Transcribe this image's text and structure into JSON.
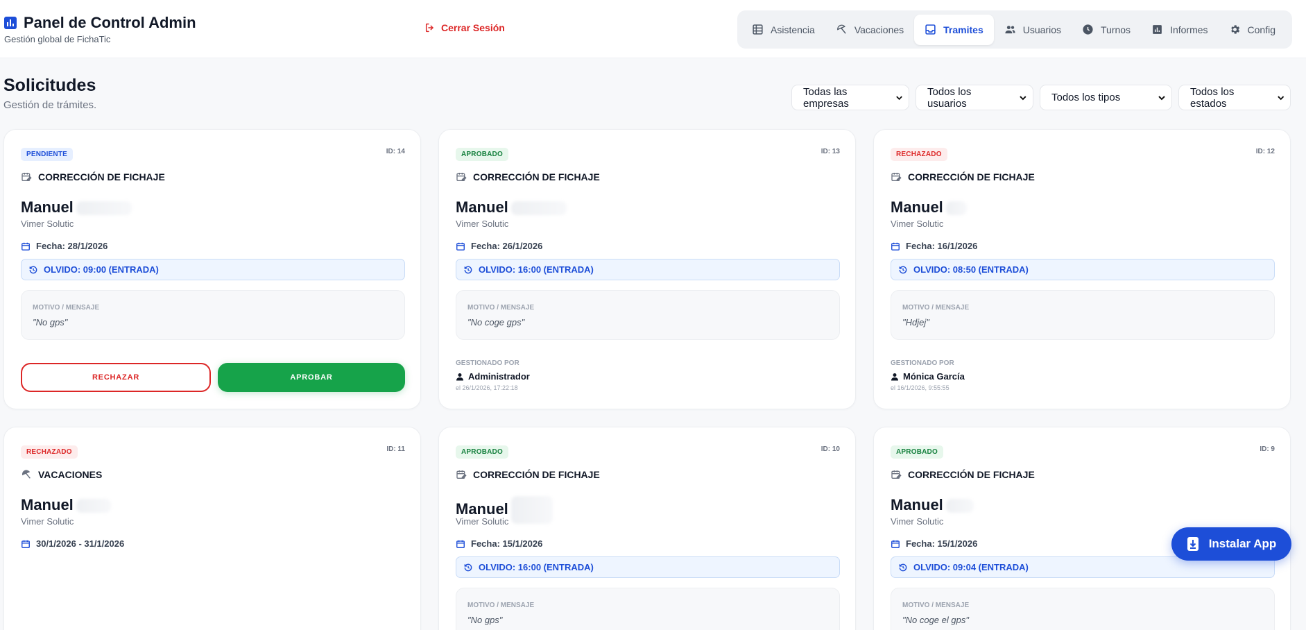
{
  "header": {
    "title": "Panel de Control Admin",
    "subtitle": "Gestión global de FichaTic",
    "logout_label": "Cerrar Sesión"
  },
  "nav": [
    {
      "label": "Asistencia",
      "icon": "table-icon",
      "active": false
    },
    {
      "label": "Vacaciones",
      "icon": "beach-umbrella-icon",
      "active": false
    },
    {
      "label": "Tramites",
      "icon": "inbox-icon",
      "active": true
    },
    {
      "label": "Usuarios",
      "icon": "users-icon",
      "active": false
    },
    {
      "label": "Turnos",
      "icon": "clock-icon",
      "active": false
    },
    {
      "label": "Informes",
      "icon": "bar-chart-icon",
      "active": false
    },
    {
      "label": "Config",
      "icon": "gear-icon",
      "active": false
    }
  ],
  "section": {
    "title": "Solicitudes",
    "subtitle": "Gestión de trámites."
  },
  "filters": [
    {
      "value": "Todas las empresas"
    },
    {
      "value": "Todos los usuarios"
    },
    {
      "value": "Todos los tipos"
    },
    {
      "value": "Todos los estados"
    }
  ],
  "labels": {
    "motivo": "MOTIVO / MENSAJE",
    "gestionado": "GESTIONADO POR",
    "reject": "RECHAZAR",
    "approve": "APROBAR"
  },
  "cards": [
    {
      "status": "PENDIENTE",
      "status_key": "pendiente",
      "id": "ID: 14",
      "type": "CORRECCIÓN DE FICHAJE",
      "type_icon": "calendar-edit-icon",
      "name": "Manuel",
      "company": "Vimer Solutic",
      "date": "Fecha: 28/1/2026",
      "olvido": "OLVIDO: 09:00 (ENTRADA)",
      "motivo": "\"No gps\"",
      "actions": true
    },
    {
      "status": "APROBADO",
      "status_key": "aprobado",
      "id": "ID: 13",
      "type": "CORRECCIÓN DE FICHAJE",
      "type_icon": "calendar-edit-icon",
      "name": "Manuel",
      "company": "Vimer Solutic",
      "date": "Fecha: 26/1/2026",
      "olvido": "OLVIDO: 16:00 (ENTRADA)",
      "motivo": "\"No coge gps\"",
      "gestionado_por": "Administrador",
      "gestionado_el": "el 26/1/2026, 17:22:18"
    },
    {
      "status": "RECHAZADO",
      "status_key": "rechazado",
      "id": "ID: 12",
      "type": "CORRECCIÓN DE FICHAJE",
      "type_icon": "calendar-edit-icon",
      "name": "Manuel",
      "company": "Vimer Solutic",
      "date": "Fecha: 16/1/2026",
      "olvido": "OLVIDO: 08:50 (ENTRADA)",
      "motivo": "\"Hdjej\"",
      "gestionado_por": "Mónica García",
      "gestionado_el": "el 16/1/2026, 9:55:55"
    },
    {
      "status": "RECHAZADO",
      "status_key": "rechazado",
      "id": "ID: 11",
      "type": "VACACIONES",
      "type_icon": "beach-umbrella-icon",
      "name": "Manuel",
      "company": "Vimer Solutic",
      "date": "30/1/2026 - 31/1/2026"
    },
    {
      "status": "APROBADO",
      "status_key": "aprobado",
      "id": "ID: 10",
      "type": "CORRECCIÓN DE FICHAJE",
      "type_icon": "calendar-edit-icon",
      "name": "Manuel",
      "company": "Vimer Solutic",
      "date": "Fecha: 15/1/2026",
      "olvido": "OLVIDO: 16:00 (ENTRADA)",
      "motivo": "\"No gps\""
    },
    {
      "status": "APROBADO",
      "status_key": "aprobado",
      "id": "ID: 9",
      "type": "CORRECCIÓN DE FICHAJE",
      "type_icon": "calendar-edit-icon",
      "name": "Manuel",
      "company": "Vimer Solutic",
      "date": "Fecha: 15/1/2026",
      "olvido": "OLVIDO: 09:04 (ENTRADA)",
      "motivo": "\"No coge el gps\""
    }
  ],
  "install_label": "Instalar App",
  "colors": {
    "accent": "#1d4ed8",
    "approve": "#16a34a",
    "reject": "#dc2626"
  }
}
